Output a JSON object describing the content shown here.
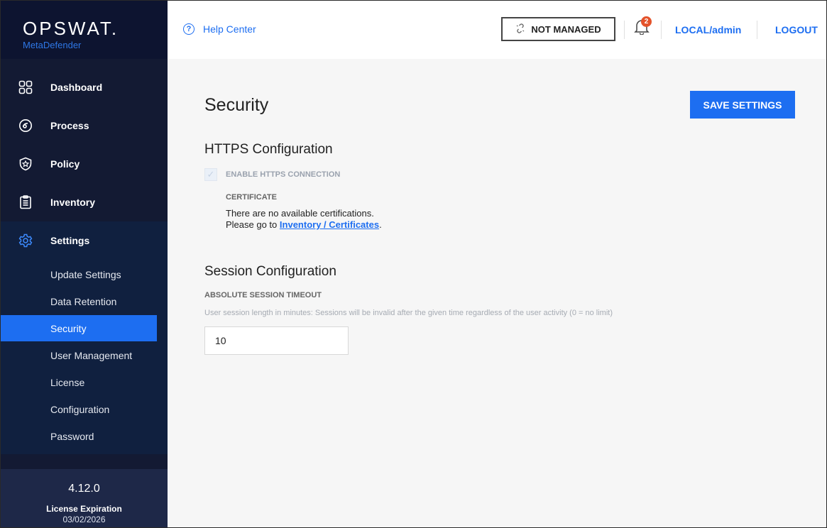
{
  "brand": {
    "name": "OPSWAT.",
    "product": "MetaDefender"
  },
  "sidebar": {
    "items": [
      {
        "label": "Dashboard",
        "icon": "dashboard-icon"
      },
      {
        "label": "Process",
        "icon": "process-icon"
      },
      {
        "label": "Policy",
        "icon": "policy-icon"
      },
      {
        "label": "Inventory",
        "icon": "inventory-icon"
      },
      {
        "label": "Settings",
        "icon": "gear-icon"
      }
    ],
    "settings_sub": [
      {
        "label": "Update Settings"
      },
      {
        "label": "Data Retention"
      },
      {
        "label": "Security",
        "active": true
      },
      {
        "label": "User Management"
      },
      {
        "label": "License"
      },
      {
        "label": "Configuration"
      },
      {
        "label": "Password"
      }
    ],
    "footer": {
      "version": "4.12.0",
      "license_label": "License Expiration",
      "license_date": "03/02/2026"
    }
  },
  "header": {
    "help": "Help Center",
    "managed_status": "NOT MANAGED",
    "notification_count": "2",
    "user": "LOCAL/admin",
    "logout": "LOGOUT"
  },
  "main": {
    "title": "Security",
    "save_label": "SAVE SETTINGS",
    "https": {
      "title": "HTTPS Configuration",
      "enable_label": "ENABLE HTTPS CONNECTION",
      "enabled": true,
      "cert_label": "CERTIFICATE",
      "cert_line1": "There are no available certifications.",
      "cert_line2_prefix": "Please go to",
      "cert_link": "Inventory / Certificates",
      "cert_line2_suffix": "."
    },
    "session": {
      "title": "Session Configuration",
      "timeout_label": "ABSOLUTE SESSION TIMEOUT",
      "timeout_desc": "User session length in minutes: Sessions will be invalid after the given time regardless of the user activity (0 = no limit)",
      "timeout_value": "10"
    }
  },
  "colors": {
    "accent": "#1d6ef1",
    "sidebar_bg": "#131a33",
    "badge": "#e4532b"
  }
}
